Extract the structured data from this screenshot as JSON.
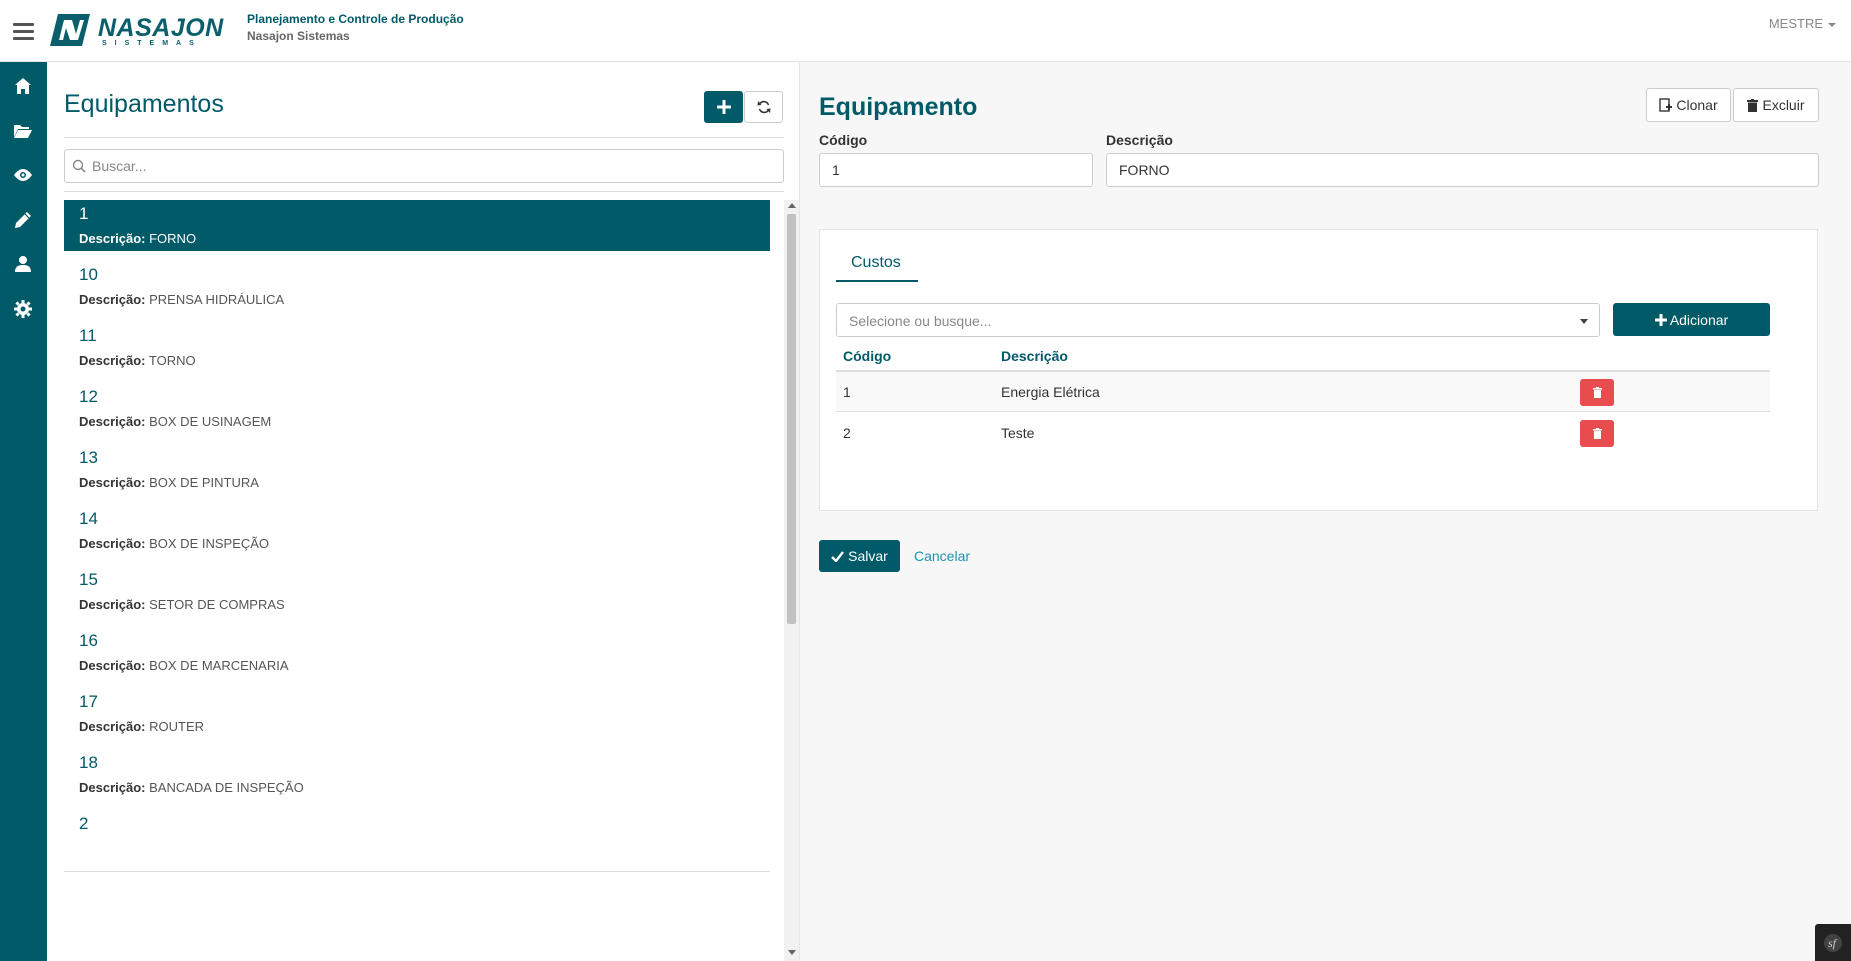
{
  "header": {
    "brand": "NASAJON",
    "brand_sub": "SISTEMAS",
    "app_title": "Planejamento e Controle de Produção",
    "company": "Nasajon Sistemas",
    "user": "MESTRE"
  },
  "sidebar": {
    "items": [
      {
        "name": "home-icon"
      },
      {
        "name": "folder-open-icon"
      },
      {
        "name": "eye-icon"
      },
      {
        "name": "pencil-icon"
      },
      {
        "name": "user-icon"
      },
      {
        "name": "gear-icon"
      }
    ]
  },
  "list": {
    "title": "Equipamentos",
    "search_placeholder": "Buscar...",
    "desc_label": "Descrição:",
    "items": [
      {
        "code": "1",
        "description": "FORNO",
        "active": true
      },
      {
        "code": "10",
        "description": "PRENSA HIDRÁULICA"
      },
      {
        "code": "11",
        "description": "TORNO"
      },
      {
        "code": "12",
        "description": "BOX DE USINAGEM"
      },
      {
        "code": "13",
        "description": "BOX DE PINTURA"
      },
      {
        "code": "14",
        "description": "BOX DE INSPEÇÃO"
      },
      {
        "code": "15",
        "description": "SETOR DE COMPRAS"
      },
      {
        "code": "16",
        "description": "BOX DE MARCENARIA"
      },
      {
        "code": "17",
        "description": "ROUTER"
      },
      {
        "code": "18",
        "description": "BANCADA DE INSPEÇÃO"
      },
      {
        "code": "2",
        "description": ""
      }
    ]
  },
  "form": {
    "title": "Equipamento",
    "clone_label": "Clonar",
    "delete_label": "Excluir",
    "codigo_label": "Código",
    "codigo_value": "1",
    "descricao_label": "Descrição",
    "descricao_value": "FORNO",
    "tab_label": "Custos",
    "select_placeholder": "Selecione ou busque...",
    "add_label": "Adicionar",
    "table": {
      "headers": [
        "Código",
        "Descrição"
      ],
      "rows": [
        {
          "codigo": "1",
          "descricao": "Energia Elétrica"
        },
        {
          "codigo": "2",
          "descricao": "Teste"
        }
      ]
    },
    "save_label": "Salvar",
    "cancel_label": "Cancelar"
  },
  "colors": {
    "primary": "#005a68",
    "danger": "#e84c4f",
    "link": "#1a95b0"
  }
}
